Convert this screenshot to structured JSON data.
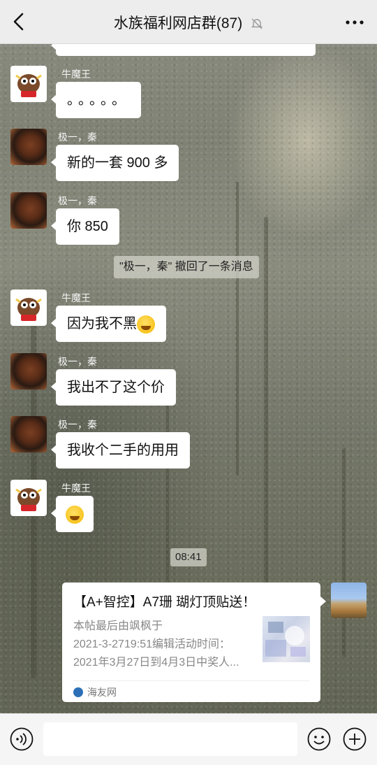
{
  "header": {
    "title": "水族福利网店群(87)",
    "mute_icon": "bell-muted-icon",
    "back_icon": "chevron-left-icon",
    "more_icon": "more-dots-icon"
  },
  "messages": [
    {
      "sender": "牛魔王",
      "text": "。。。。。"
    },
    {
      "sender": "极一，秦",
      "text": "新的一套 900 多"
    },
    {
      "sender": "极一，秦",
      "text": "你 850"
    },
    {
      "system": "\"极一，秦\" 撤回了一条消息"
    },
    {
      "sender": "牛魔王",
      "text": "因为我不黑"
    },
    {
      "sender": "极一，秦",
      "text": "我出不了这个价"
    },
    {
      "sender": "极一，秦",
      "text": "我收个二手的用用"
    },
    {
      "sender": "牛魔王",
      "text": ""
    }
  ],
  "time_divider": "08:41",
  "link_card": {
    "title": "【A+智控】A7珊 瑚灯顶贴送！",
    "desc_line1": "本帖最后由飒枫于",
    "desc_line2": "2021-3-2719:51编辑活动时间：",
    "desc_line3": "2021年3月27日到4月3日中奖人...",
    "source": "海友网"
  },
  "input": {
    "voice_icon": "voice-icon",
    "emoji_icon": "emoji-icon",
    "plus_icon": "plus-icon"
  },
  "colors": {
    "header_bg": "#ededed",
    "bubble_bg": "#ffffff",
    "input_bg": "#f5f5f5"
  }
}
